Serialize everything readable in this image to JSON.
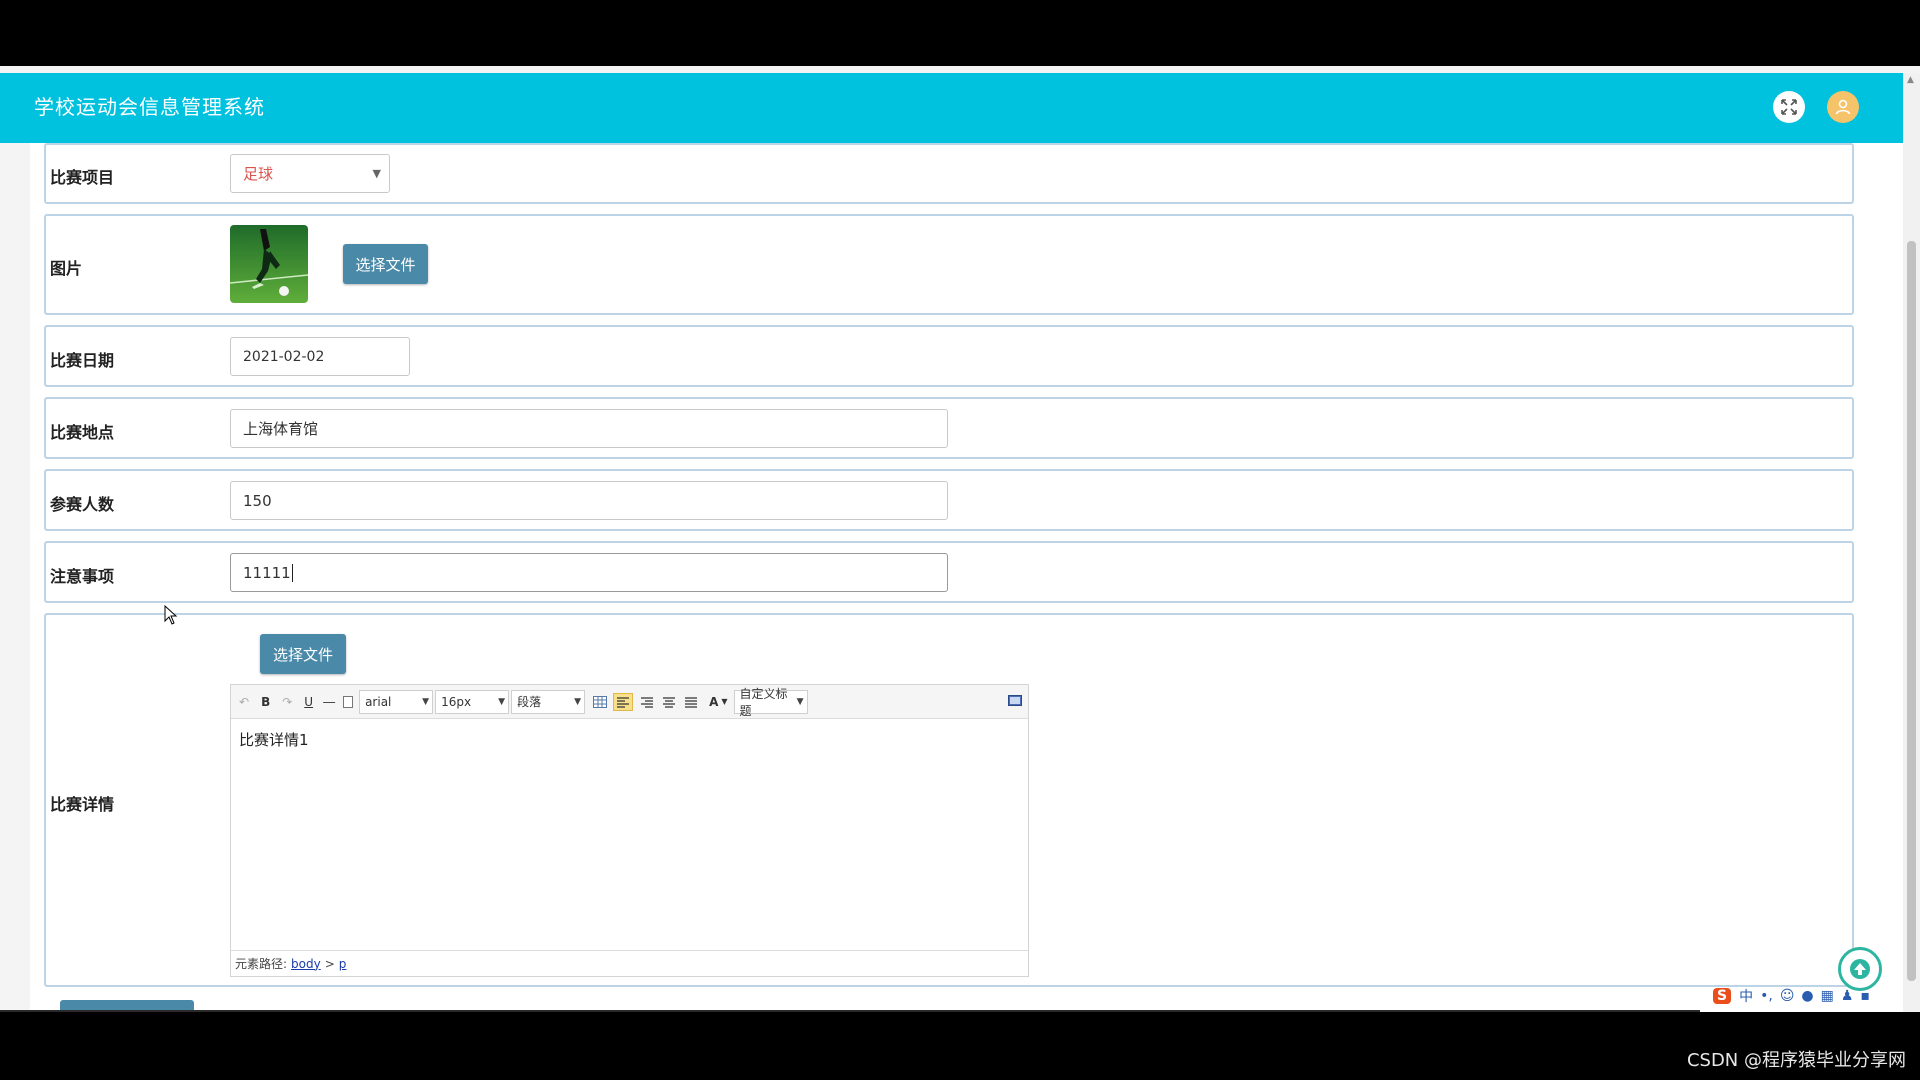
{
  "app": {
    "title": "学校运动会信息管理系统"
  },
  "icons": {
    "fullscreen": "fullscreen-toggle-icon",
    "user": "user-avatar-icon",
    "back_to_top": "arrow-up-icon"
  },
  "colors": {
    "header": "#00c1de",
    "button": "#4a8aa8",
    "select_value": "#d9534f",
    "row_border": "#bcd4e6"
  },
  "form": {
    "project": {
      "label": "比赛项目",
      "value": "足球"
    },
    "image": {
      "label": "图片",
      "button": "选择文件"
    },
    "date": {
      "label": "比赛日期",
      "value": "2021-02-02"
    },
    "location": {
      "label": "比赛地点",
      "value": "上海体育馆"
    },
    "participants": {
      "label": "参赛人数",
      "value": "150"
    },
    "notes": {
      "label": "注意事项",
      "value": "11111"
    },
    "details": {
      "label": "比赛详情",
      "button": "选择文件",
      "toolbar": {
        "bold": "B",
        "underline": "U",
        "font_family": "arial",
        "font_size": "16px",
        "paragraph": "段落",
        "font_color": "A",
        "custom_title": "自定义标题"
      },
      "content": "比赛详情1",
      "path_label": "元素路径:",
      "path_body": "body",
      "path_sep": ">",
      "path_p": "p"
    }
  },
  "ime": {
    "logo": "S",
    "mode": "中"
  },
  "watermark": "CSDN @程序猿毕业分享网"
}
